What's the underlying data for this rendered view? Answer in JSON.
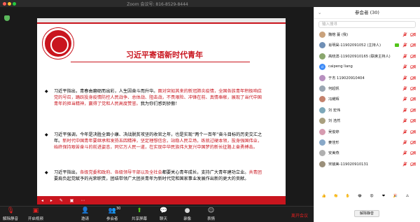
{
  "window": {
    "title": "Zoom 会议号: 816-8529-8444"
  },
  "slide": {
    "title": "习近平寄语新时代青年",
    "para1_a": "习近平指出，青春由磨砺而出彩，人生因奋斗而升华。",
    "para1_b": "面对突如其来的新冠肺炎疫情，全国各族青年积极响应党的号召，踊跃投身疫情防控人民战争、总体战、阻击战，不畏艰险、冲锋在前、真情奉献，展现了当代中国青年的担当精神，赢得了党和人民高度赞誉。",
    "para1_c": "我为你们感到骄傲！",
    "para2_a": "习近平强调，今年是决胜全面小康、决战脱贫攻坚的收官之年，也是实现“两个一百年”奋斗目标的历史交汇之年。",
    "para2_b": "新时代中国青年要继承和发扬五四精神，坚定理想信念，站稳人民立场，练就过硬本领，投身强国伟业，始终保持艰苦奋斗的前进姿态，同亿万人民一道，在实现中华民族伟大复兴中国梦的新长征路上奋勇搏击。",
    "para3_a": "习近平指出，",
    "para3_b": "各级党委和政府、各级领导干部以及全社会",
    "para3_c": "都要关心青年成长，支持广大青年建功立业。",
    "para3_d": "共青团",
    "para3_e": "要肩负起党赋予的光荣职责，团结带领广大团员青年为新时代党和国家事业发展作出新的更大的贡献。"
  },
  "toolbar": {
    "unmute": "解除静音",
    "video": "开启视频",
    "invite": "邀请",
    "participants": "参会者",
    "participants_count": "30",
    "share": "共享屏幕",
    "chat": "聊天",
    "record": "录像",
    "reactions": "表情",
    "end": "离开会议"
  },
  "panel": {
    "header": "参会者 (30)",
    "search_placeholder": "输入搜寻",
    "unmute_all": "解除静音",
    "participants": [
      {
        "name": "魏榕 蔓 (我)",
        "avatar_text": ""
      },
      {
        "name": "肖明昊-11902091052 (主持人)",
        "avatar_text": ""
      },
      {
        "name": "高晓滨-119020910165 (联席主持人)",
        "avatar_text": ""
      },
      {
        "name": "caipeng liang",
        "avatar_text": "cl"
      },
      {
        "name": "于杰 119020910404",
        "avatar_text": ""
      },
      {
        "name": "何起帆",
        "avatar_text": ""
      },
      {
        "name": "冯耀辉",
        "avatar_text": ""
      },
      {
        "name": "刘 宏伟",
        "avatar_text": ""
      },
      {
        "name": "刘 浩然",
        "avatar_text": ""
      },
      {
        "name": "吴俊婷",
        "avatar_text": ""
      },
      {
        "name": "姜佳形",
        "avatar_text": ""
      },
      {
        "name": "安美燕",
        "avatar_text": ""
      },
      {
        "name": "宋毓美-119020910131",
        "avatar_text": ""
      }
    ],
    "reactions": [
      "👍",
      "👏",
      "✋",
      "😂",
      "😮",
      "❤",
      "🎉",
      "⚠"
    ]
  },
  "colors": {
    "accent_red": "#c9151e",
    "mute_red": "#e02020",
    "share_green": "#52c41a"
  }
}
